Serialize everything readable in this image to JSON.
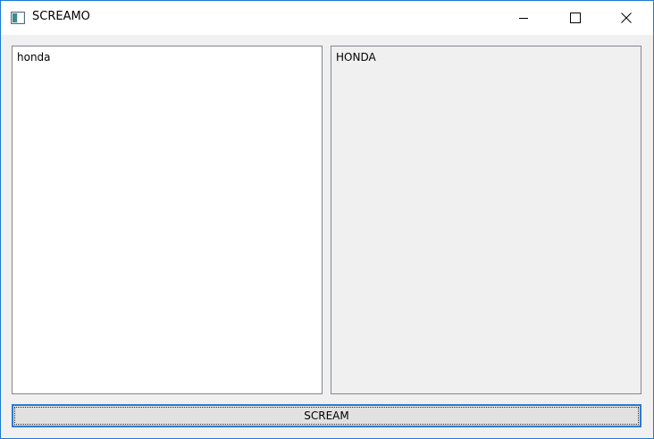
{
  "window": {
    "title": "SCREAMO",
    "icon": "window-app-icon",
    "controls": [
      "minimize-icon",
      "maximize-icon",
      "close-icon"
    ]
  },
  "input_panel": {
    "text": "honda"
  },
  "output_panel": {
    "text": "HONDA"
  },
  "scream_button": {
    "label": "SCREAM"
  },
  "colors": {
    "accent_border": "#2b7ad4",
    "window_background": "#f0f0f0"
  }
}
